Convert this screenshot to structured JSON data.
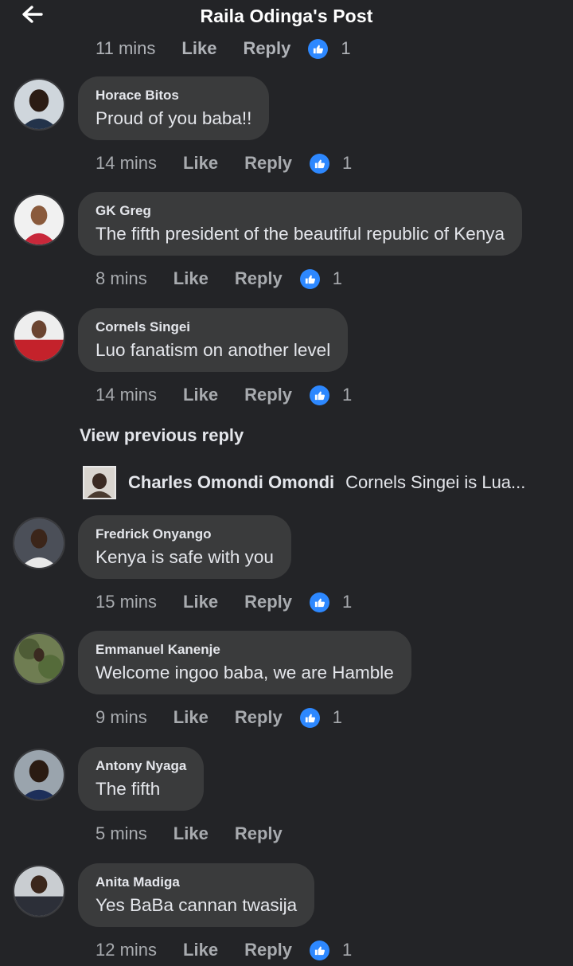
{
  "header": {
    "title": "Raila Odinga's Post",
    "back_icon": "arrow-left-icon"
  },
  "clipped_row": {
    "time": "11 mins",
    "like": "Like",
    "reply": "Reply",
    "count": "1"
  },
  "comments": [
    {
      "author": "Horace Bitos",
      "text": "Proud of you baba!!",
      "time": "14 mins",
      "like": "Like",
      "reply": "Reply",
      "reactions": "1"
    },
    {
      "author": "GK Greg",
      "text": "The fifth president of the beautiful republic of Kenya",
      "time": "8 mins",
      "like": "Like",
      "reply": "Reply",
      "reactions": "1"
    },
    {
      "author": "Cornels Singei",
      "text": "Luo fanatism on another level",
      "time": "14 mins",
      "like": "Like",
      "reply": "Reply",
      "reactions": "1"
    },
    {
      "author": "Fredrick Onyango",
      "text": "Kenya is safe with you",
      "time": "15 mins",
      "like": "Like",
      "reply": "Reply",
      "reactions": "1"
    },
    {
      "author": "Emmanuel Kanenje",
      "text": "Welcome ingoo baba, we are Hamble",
      "time": "9 mins",
      "like": "Like",
      "reply": "Reply",
      "reactions": "1"
    },
    {
      "author": "Antony Nyaga",
      "text": "The fifth",
      "time": "5 mins",
      "like": "Like",
      "reply": "Reply",
      "reactions": ""
    },
    {
      "author": "Anita Madiga",
      "text": "Yes BaBa cannan twasija",
      "time": "12 mins",
      "like": "Like",
      "reply": "Reply",
      "reactions": "1"
    }
  ],
  "view_previous": "View previous reply",
  "reply_preview": {
    "author": "Charles Omondi Omondi",
    "text": "Cornels Singei is Lua..."
  },
  "colors": {
    "background": "#232427",
    "bubble": "#3a3b3c",
    "like_blue": "#2d88ff",
    "muted": "#a8abaf"
  }
}
